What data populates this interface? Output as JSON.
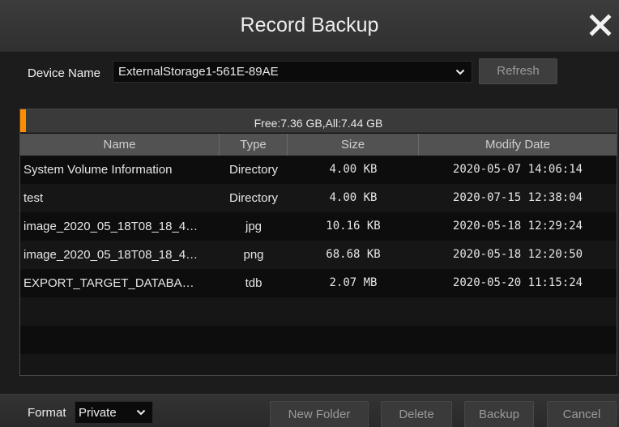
{
  "window": {
    "title": "Record Backup",
    "close_icon": "close-icon"
  },
  "device": {
    "label": "Device Name",
    "value": "ExternalStorage1-561E-89AE",
    "refresh_label": "Refresh"
  },
  "storage": {
    "text": "Free:7.36 GB,All:7.44 GB",
    "used_fraction": 0.01,
    "bar_color": "#ff8c00"
  },
  "table": {
    "headers": [
      "Name",
      "Type",
      "Size",
      "Modify Date"
    ],
    "rows": [
      {
        "name": "System Volume Information",
        "type": "Directory",
        "size": "4.00 KB",
        "date": "2020-05-07 14:06:14"
      },
      {
        "name": "test",
        "type": "Directory",
        "size": "4.00 KB",
        "date": "2020-07-15 12:38:04"
      },
      {
        "name": "image_2020_05_18T08_18_4…",
        "type": "jpg",
        "size": "10.16 KB",
        "date": "2020-05-18 12:29:24"
      },
      {
        "name": "image_2020_05_18T08_18_4…",
        "type": "png",
        "size": "68.68 KB",
        "date": "2020-05-18 12:20:50"
      },
      {
        "name": "EXPORT_TARGET_DATABA…",
        "type": "tdb",
        "size": "2.07 MB",
        "date": "2020-05-20 11:15:24"
      }
    ]
  },
  "footer": {
    "format_label": "Format",
    "format_value": "Private",
    "new_folder_label": "New Folder",
    "delete_label": "Delete",
    "backup_label": "Backup",
    "cancel_label": "Cancel"
  }
}
